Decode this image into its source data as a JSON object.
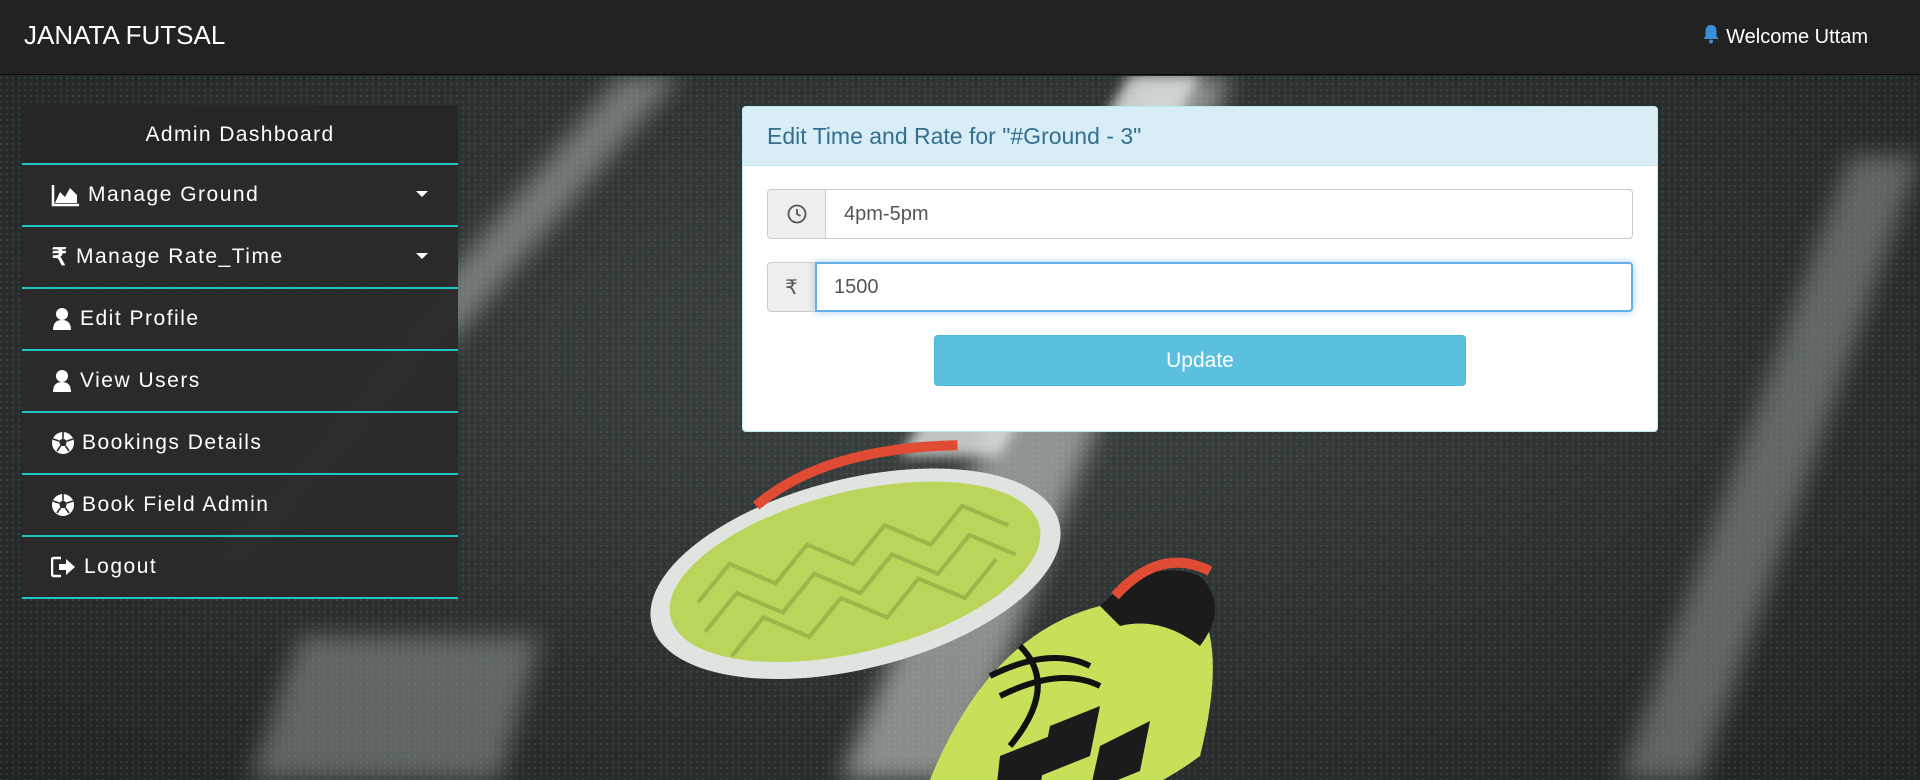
{
  "navbar": {
    "brand": "JANATA FUTSAL",
    "welcome": "Welcome Uttam",
    "bell_icon": "bell-icon"
  },
  "sidebar": {
    "header": "Admin Dashboard",
    "items": [
      {
        "label": "Manage Ground",
        "icon": "area-chart-icon",
        "has_caret": true
      },
      {
        "label": "Manage Rate_Time",
        "icon": "rupee-icon",
        "has_caret": true
      },
      {
        "label": "Edit Profile",
        "icon": "user-icon",
        "has_caret": false
      },
      {
        "label": "View Users",
        "icon": "user-icon",
        "has_caret": false
      },
      {
        "label": "Bookings Details",
        "icon": "soccer-ball-icon",
        "has_caret": false
      },
      {
        "label": "Book Field Admin",
        "icon": "soccer-ball-icon",
        "has_caret": false
      },
      {
        "label": "Logout",
        "icon": "logout-icon",
        "has_caret": false
      }
    ],
    "accent_color": "#1fc6c1"
  },
  "panel": {
    "title": "Edit Time and Rate for \"#Ground - 3\"",
    "time_field": {
      "icon": "clock-icon",
      "value": "4pm-5pm"
    },
    "rate_field": {
      "icon": "rupee-icon",
      "symbol": "₹",
      "value": "1500"
    },
    "update_label": "Update",
    "update_color": "#5bc0de"
  }
}
